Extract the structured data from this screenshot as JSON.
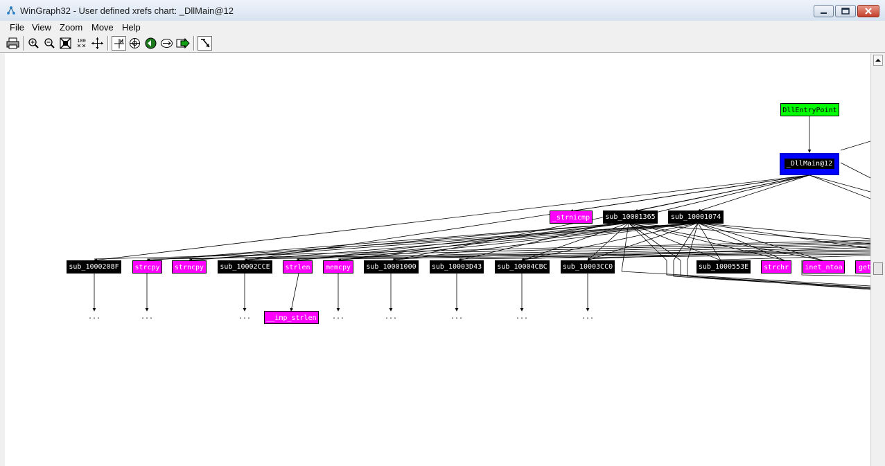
{
  "window": {
    "title": "WinGraph32 - User defined xrefs chart: _DllMain@12",
    "controls": [
      "minimize",
      "maximize",
      "close"
    ]
  },
  "menu": [
    "File",
    "View",
    "Zoom",
    "Move",
    "Help"
  ],
  "toolbar": {
    "buttons": [
      "print-icon",
      "zoom-in-icon",
      "zoom-out-icon",
      "fit-window-icon",
      "zoom-100-icon",
      "center-icon",
      "layout-icon",
      "overview-icon",
      "node-info-icon",
      "edge-info-icon",
      "follow-icon",
      "arrow-mode-icon"
    ],
    "zoom_100_label": "100"
  },
  "graph": {
    "nodes": {
      "dllentrypoint": "DllEntryPoint",
      "dllmain": "_DllMain@12",
      "strnicmp": "_strnicmp",
      "sub_10001365": "sub_10001365",
      "sub_10001074": "sub_10001074",
      "sub_1000208f": "sub_1000208F",
      "strcpy": "strcpy",
      "strncpy": "strncpy",
      "sub_10002cce": "sub_10002CCE",
      "strlen": "strlen",
      "memcpy": "memcpy",
      "sub_10001000": "sub_10001000",
      "sub_10003d43": "sub_10003D43",
      "sub_10004cbc": "sub_10004CBC",
      "sub_10003cc0": "sub_10003CC0",
      "sub_1000553e": "sub_1000553E",
      "strchr": "strchr",
      "inet_ntoa": "inet_ntoa",
      "get": "get",
      "imp_strlen": "__imp_strlen"
    },
    "ellipsis": "..."
  },
  "colors": {
    "entry_node": "#00ff00",
    "selected_node": "#0000ff",
    "library_node": "#ff00ff",
    "function_node": "#000000"
  }
}
